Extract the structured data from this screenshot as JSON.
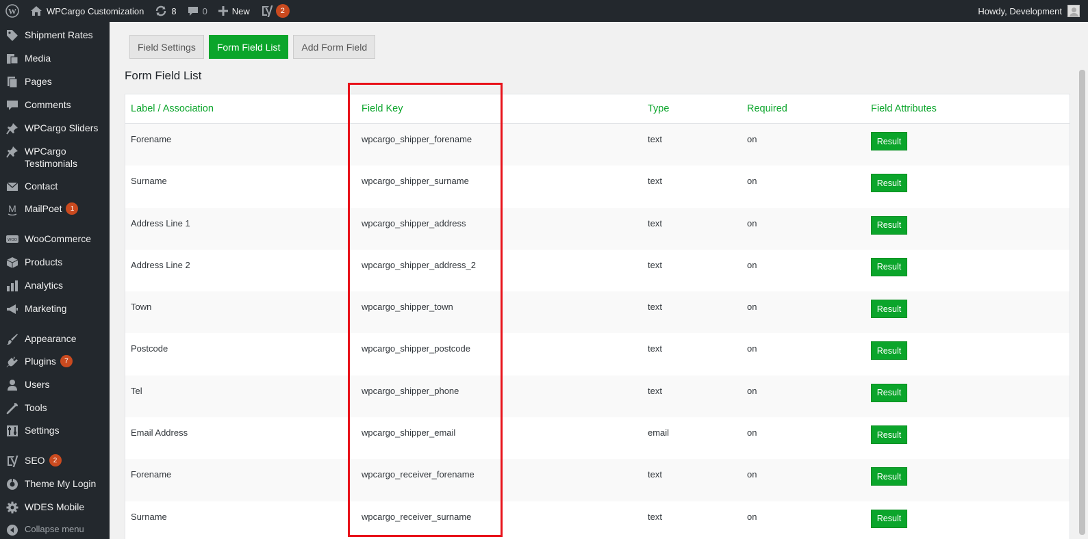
{
  "admin_bar": {
    "site_name": "WPCargo Customization",
    "updates_count": "8",
    "comments_count": "0",
    "new_label": "New",
    "seo_badge": "2",
    "greeting": "Howdy, Development"
  },
  "sidebar": {
    "items": [
      {
        "label": "Shipment Rates",
        "icon": "tag-icon"
      },
      {
        "label": "Media",
        "icon": "media-icon"
      },
      {
        "label": "Pages",
        "icon": "pages-icon"
      },
      {
        "label": "Comments",
        "icon": "comment-icon"
      },
      {
        "label": "WPCargo Sliders",
        "icon": "pin-icon"
      },
      {
        "label": "WPCargo Testimonials",
        "icon": "pin-icon"
      },
      {
        "label": "Contact",
        "icon": "mail-icon"
      },
      {
        "label": "MailPoet",
        "icon": "mailpoet-icon",
        "badge": "1"
      },
      {
        "label": "WooCommerce",
        "icon": "woo-icon"
      },
      {
        "label": "Products",
        "icon": "box-icon"
      },
      {
        "label": "Analytics",
        "icon": "chart-icon"
      },
      {
        "label": "Marketing",
        "icon": "megaphone-icon"
      },
      {
        "label": "Appearance",
        "icon": "brush-icon"
      },
      {
        "label": "Plugins",
        "icon": "plug-icon",
        "badge": "7"
      },
      {
        "label": "Users",
        "icon": "user-icon"
      },
      {
        "label": "Tools",
        "icon": "wrench-icon"
      },
      {
        "label": "Settings",
        "icon": "sliders-icon"
      },
      {
        "label": "SEO",
        "icon": "yoast-icon",
        "badge": "2"
      },
      {
        "label": "Theme My Login",
        "icon": "theme-login-icon"
      },
      {
        "label": "WDES Mobile",
        "icon": "gear-icon"
      }
    ],
    "collapse_label": "Collapse menu"
  },
  "tabs": [
    {
      "label": "Field Settings",
      "active": false
    },
    {
      "label": "Form Field List",
      "active": true
    },
    {
      "label": "Add Form Field",
      "active": false
    }
  ],
  "heading": "Form Field List",
  "table": {
    "headers": [
      "Label / Association",
      "Field Key",
      "Type",
      "Required",
      "Field Attributes"
    ],
    "rows": [
      {
        "label": "Forename",
        "key": "wpcargo_shipper_forename",
        "type": "text",
        "required": "on",
        "action": "Result"
      },
      {
        "label": "Surname",
        "key": "wpcargo_shipper_surname",
        "type": "text",
        "required": "on",
        "action": "Result"
      },
      {
        "label": "Address Line 1",
        "key": "wpcargo_shipper_address",
        "type": "text",
        "required": "on",
        "action": "Result"
      },
      {
        "label": "Address Line 2",
        "key": "wpcargo_shipper_address_2",
        "type": "text",
        "required": "on",
        "action": "Result"
      },
      {
        "label": "Town",
        "key": "wpcargo_shipper_town",
        "type": "text",
        "required": "on",
        "action": "Result"
      },
      {
        "label": "Postcode",
        "key": "wpcargo_shipper_postcode",
        "type": "text",
        "required": "on",
        "action": "Result"
      },
      {
        "label": "Tel",
        "key": "wpcargo_shipper_phone",
        "type": "text",
        "required": "on",
        "action": "Result"
      },
      {
        "label": "Email Address",
        "key": "wpcargo_shipper_email",
        "type": "email",
        "required": "on",
        "action": "Result"
      },
      {
        "label": "Forename",
        "key": "wpcargo_receiver_forename",
        "type": "text",
        "required": "on",
        "action": "Result"
      },
      {
        "label": "Surname",
        "key": "wpcargo_receiver_surname",
        "type": "text",
        "required": "on",
        "action": "Result"
      }
    ]
  },
  "colors": {
    "accent": "#0ba52b",
    "admin_bg": "#23282d",
    "badge": "#ca4a1f",
    "highlight": "#e8121a"
  }
}
